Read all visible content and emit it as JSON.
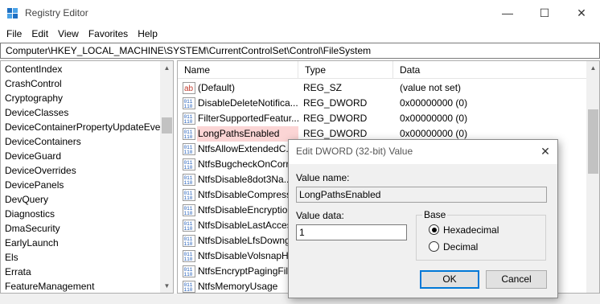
{
  "window": {
    "title": "Registry Editor",
    "min_glyph": "—",
    "max_glyph": "☐",
    "close_glyph": "✕"
  },
  "menu": [
    "File",
    "Edit",
    "View",
    "Favorites",
    "Help"
  ],
  "address": "Computer\\HKEY_LOCAL_MACHINE\\SYSTEM\\CurrentControlSet\\Control\\FileSystem",
  "tree": {
    "items": [
      "ContentIndex",
      "CrashControl",
      "Cryptography",
      "DeviceClasses",
      "DeviceContainerPropertyUpdateEver",
      "DeviceContainers",
      "DeviceGuard",
      "DeviceOverrides",
      "DevicePanels",
      "DevQuery",
      "Diagnostics",
      "DmaSecurity",
      "EarlyLaunch",
      "Els",
      "Errata",
      "FeatureManagement"
    ]
  },
  "list": {
    "columns": [
      "Name",
      "Type",
      "Data"
    ],
    "rows": [
      {
        "name": "(Default)",
        "type": "REG_SZ",
        "data": "(value not set)",
        "icon": "string-value-icon"
      },
      {
        "name": "DisableDeleteNotifica...",
        "type": "REG_DWORD",
        "data": "0x00000000 (0)",
        "icon": "binary-value-icon"
      },
      {
        "name": "FilterSupportedFeatur...",
        "type": "REG_DWORD",
        "data": "0x00000000 (0)",
        "icon": "binary-value-icon"
      },
      {
        "name": "LongPathsEnabled",
        "type": "REG_DWORD",
        "data": "0x00000000 (0)",
        "icon": "binary-value-icon"
      },
      {
        "name": "NtfsAllowExtendedC...",
        "type": "",
        "data": "",
        "icon": "binary-value-icon"
      },
      {
        "name": "NtfsBugcheckOnCorr",
        "type": "",
        "data": "",
        "icon": "binary-value-icon"
      },
      {
        "name": "NtfsDisable8dot3Na...",
        "type": "",
        "data": "",
        "icon": "binary-value-icon"
      },
      {
        "name": "NtfsDisableCompress",
        "type": "",
        "data": "",
        "icon": "binary-value-icon"
      },
      {
        "name": "NtfsDisableEncryption",
        "type": "",
        "data": "",
        "icon": "binary-value-icon"
      },
      {
        "name": "NtfsDisableLastAcces...",
        "type": "",
        "data": "",
        "icon": "binary-value-icon"
      },
      {
        "name": "NtfsDisableLfsDowng",
        "type": "",
        "data": "",
        "icon": "binary-value-icon"
      },
      {
        "name": "NtfsDisableVolsnapHi",
        "type": "",
        "data": "",
        "icon": "binary-value-icon"
      },
      {
        "name": "NtfsEncryptPagingFile",
        "type": "",
        "data": "",
        "icon": "binary-value-icon"
      },
      {
        "name": "NtfsMemoryUsage",
        "type": "",
        "data": "",
        "icon": "binary-value-icon"
      }
    ],
    "selected_index": 3
  },
  "dialog": {
    "title": "Edit DWORD (32-bit) Value",
    "close_glyph": "✕",
    "value_name_label": "Value name:",
    "value_name": "LongPathsEnabled",
    "value_data_label": "Value data:",
    "value_data": "1",
    "base_label": "Base",
    "base_options": [
      "Hexadecimal",
      "Decimal"
    ],
    "base_selected": "Hexadecimal",
    "ok_label": "OK",
    "cancel_label": "Cancel"
  },
  "colors": {
    "selection": "#fbd5d5",
    "accent": "#0078d7"
  }
}
